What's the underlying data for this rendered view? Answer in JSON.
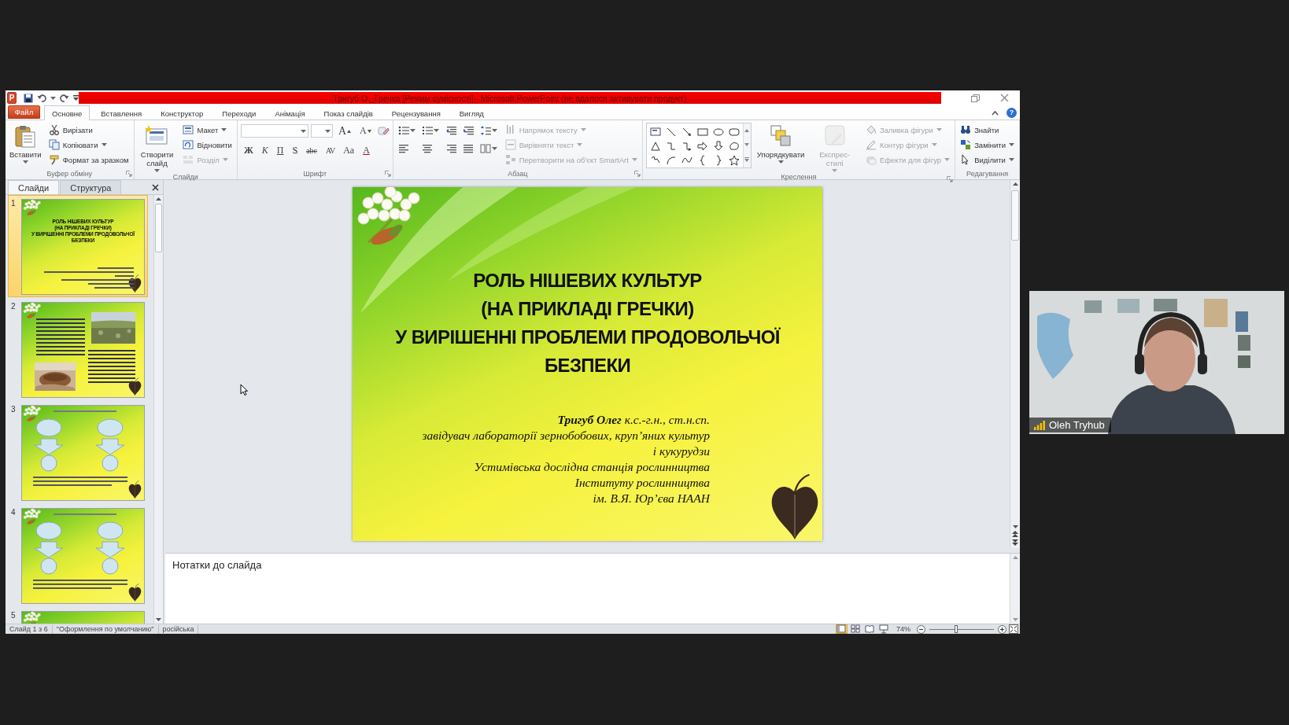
{
  "window": {
    "logo": "P",
    "title": "Тригуб О._Гречка [Режим сумісності] - Microsoft PowerPoint (не вдалося активувати продукт)",
    "help": "?"
  },
  "tabs": [
    {
      "label": "Файл",
      "kind": "file",
      "selected": false
    },
    {
      "label": "Основне",
      "kind": "tab",
      "selected": true
    },
    {
      "label": "Вставлення",
      "kind": "tab",
      "selected": false
    },
    {
      "label": "Конструктор",
      "kind": "tab",
      "selected": false
    },
    {
      "label": "Переходи",
      "kind": "tab",
      "selected": false
    },
    {
      "label": "Анімація",
      "kind": "tab",
      "selected": false
    },
    {
      "label": "Показ слайдів",
      "kind": "tab",
      "selected": false
    },
    {
      "label": "Рецензування",
      "kind": "tab",
      "selected": false
    },
    {
      "label": "Вигляд",
      "kind": "tab",
      "selected": false
    }
  ],
  "ribbon": {
    "groups": [
      {
        "label": "Буфер обміну",
        "launcher": true,
        "parts": [
          {
            "kind": "large",
            "label": "Вставити",
            "dropdown": true,
            "disabled": false
          },
          {
            "kind": "column",
            "items": [
              {
                "label": "Вирізати",
                "dropdown": false,
                "disabled": false
              },
              {
                "label": "Копіювати",
                "dropdown": true,
                "disabled": false
              },
              {
                "label": "Формат за зразком",
                "dropdown": false,
                "disabled": false
              }
            ]
          }
        ]
      },
      {
        "label": "Слайди",
        "launcher": false,
        "parts": [
          {
            "kind": "large",
            "label": "Створити слайд",
            "dropdown": true,
            "disabled": false
          },
          {
            "kind": "column",
            "items": [
              {
                "label": "Макет",
                "dropdown": true,
                "disabled": false
              },
              {
                "label": "Відновити",
                "dropdown": false,
                "disabled": false
              },
              {
                "label": "Розділ",
                "dropdown": true,
                "disabled": true
              }
            ]
          }
        ]
      },
      {
        "label": "Шрифт",
        "launcher": true,
        "parts": [
          {
            "kind": "font",
            "size_buttons": [
              "A",
              "A"
            ],
            "buttons": [
              "Ж",
              "К",
              "П",
              "S",
              "abc",
              "AV",
              "Aa",
              "A"
            ]
          }
        ]
      },
      {
        "label": "Абзац",
        "launcher": true,
        "parts": [
          {
            "kind": "paragraph"
          },
          {
            "kind": "column",
            "items": [
              {
                "label": "Напрямок тексту",
                "dropdown": true,
                "disabled": true
              },
              {
                "label": "Вирівняти текст",
                "dropdown": true,
                "disabled": true
              },
              {
                "label": "Перетворити на об'єкт SmartArt",
                "dropdown": true,
                "disabled": true
              }
            ]
          }
        ]
      },
      {
        "label": "Креслення",
        "launcher": true,
        "parts": [
          {
            "kind": "gallery"
          },
          {
            "kind": "large",
            "label": "Упорядкувати",
            "dropdown": true,
            "disabled": false
          },
          {
            "kind": "large",
            "label": "Експрес-стилі",
            "dropdown": true,
            "disabled": true
          },
          {
            "kind": "column",
            "items": [
              {
                "label": "Заливка фігури",
                "dropdown": true,
                "disabled": true
              },
              {
                "label": "Контур фігури",
                "dropdown": true,
                "disabled": true
              },
              {
                "label": "Ефекти для фігур",
                "dropdown": true,
                "disabled": true
              }
            ]
          }
        ]
      },
      {
        "label": "Редагування",
        "launcher": false,
        "parts": [
          {
            "kind": "column",
            "items": [
              {
                "label": "Знайти",
                "dropdown": false,
                "disabled": false
              },
              {
                "label": "Замінити",
                "dropdown": true,
                "disabled": false
              },
              {
                "label": "Виділити",
                "dropdown": true,
                "disabled": false
              }
            ]
          }
        ]
      }
    ]
  },
  "slide_panel": {
    "tabs": [
      {
        "label": "Слайди",
        "selected": true
      },
      {
        "label": "Структура",
        "selected": false
      }
    ],
    "thumbnails": [
      {
        "number": "1",
        "kind": "title",
        "selected": true,
        "title_lines": [
          "РОЛЬ НІШЕВИХ КУЛЬТУР",
          "(НА ПРИКЛАДІ ГРЕЧКИ)",
          "У ВИРІШЕННІ ПРОБЛЕМИ ПРОДОВОЛЬЧОЇ",
          "БЕЗПЕКИ"
        ]
      },
      {
        "number": "2",
        "kind": "text-photo",
        "selected": false
      },
      {
        "number": "3",
        "kind": "diagram",
        "selected": false
      },
      {
        "number": "4",
        "kind": "diagram",
        "selected": false
      },
      {
        "number": "5",
        "kind": "partial",
        "selected": false
      }
    ]
  },
  "slide": {
    "title_lines": [
      "РОЛЬ НІШЕВИХ КУЛЬТУР",
      "(НА ПРИКЛАДІ ГРЕЧКИ)",
      "У ВИРІШЕННІ ПРОБЛЕМИ ПРОДОВОЛЬЧОЇ",
      "БЕЗПЕКИ"
    ],
    "author_lines": [
      "**Тригуб Олег** к.с.-г.н., ст.н.сп.",
      "завідувач лабораторії зернобобових, круп’яних культур",
      "і кукурудзи",
      "Устимівська дослідна станція рослинництва",
      "Інституту рослинництва",
      "ім. В.Я. Юр’єва НААН"
    ]
  },
  "notes": {
    "text": "Нотатки до слайда"
  },
  "status_bar": {
    "slide": "Слайд 1 з 6",
    "theme": "\"Оформлення по умолчанию\"",
    "language": "російська",
    "views": [
      {
        "selected": true
      },
      {
        "selected": false
      },
      {
        "selected": false
      },
      {
        "selected": false
      }
    ],
    "zoom": "74%",
    "zoom_slider": {
      "level": 0.42
    }
  },
  "video": {
    "name": "Oleh Tryhub"
  }
}
